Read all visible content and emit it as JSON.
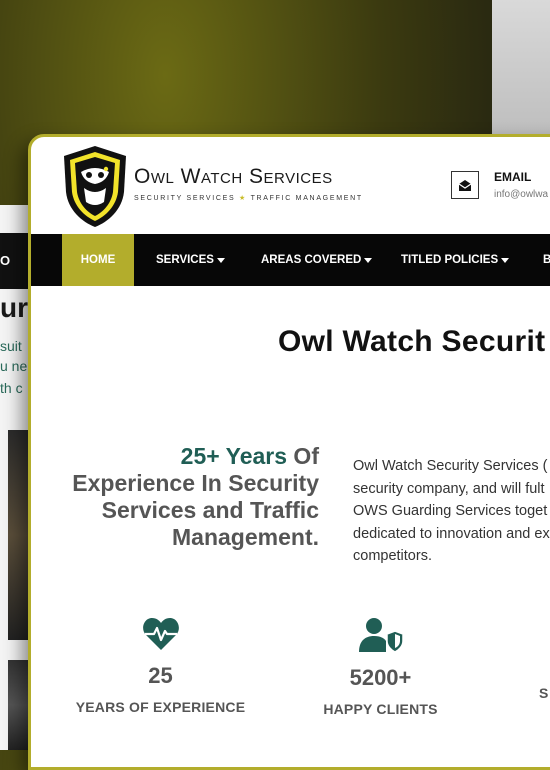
{
  "background": {
    "nav_fragment": "O",
    "title_fragment": "ur",
    "text_lines": [
      "suit",
      "u ne",
      "th c"
    ]
  },
  "header": {
    "brand_name": "Owl Watch Services",
    "brand_tagline_left": "SECURITY SERVICES",
    "brand_tagline_right": "TRAFFIC MANAGEMENT",
    "email_label": "EMAIL",
    "email_value": "info@owlwa"
  },
  "nav": {
    "items": [
      {
        "label": "HOME",
        "active": true,
        "dropdown": false
      },
      {
        "label": "SERVICES",
        "active": false,
        "dropdown": true
      },
      {
        "label": "AREAS COVERED",
        "active": false,
        "dropdown": true
      },
      {
        "label": "TITLED POLICIES",
        "active": false,
        "dropdown": true
      },
      {
        "label": "B",
        "active": false,
        "dropdown": false
      }
    ]
  },
  "hero": {
    "title": "Owl Watch Securit"
  },
  "experience": {
    "accent": "25+ Years",
    "rest_line1": " Of",
    "line2": "Experience In Security",
    "line3": "Services and Traffic",
    "line4": "Management."
  },
  "about": {
    "lines": [
      "Owl Watch Security Services (",
      "security company, and will fult",
      "OWS Guarding Services toget",
      "dedicated to innovation and ex",
      "competitors."
    ]
  },
  "stats": [
    {
      "icon": "heartbeat-icon",
      "value": "25",
      "label": "YEARS OF EXPERIENCE"
    },
    {
      "icon": "user-shield-icon",
      "value": "5200+",
      "label": "HAPPY CLIENTS"
    },
    {
      "icon": "",
      "value": "",
      "label": "S"
    }
  ],
  "colors": {
    "accent": "#b3ad2c",
    "teal": "#205e55",
    "nav_bg": "#070707"
  }
}
